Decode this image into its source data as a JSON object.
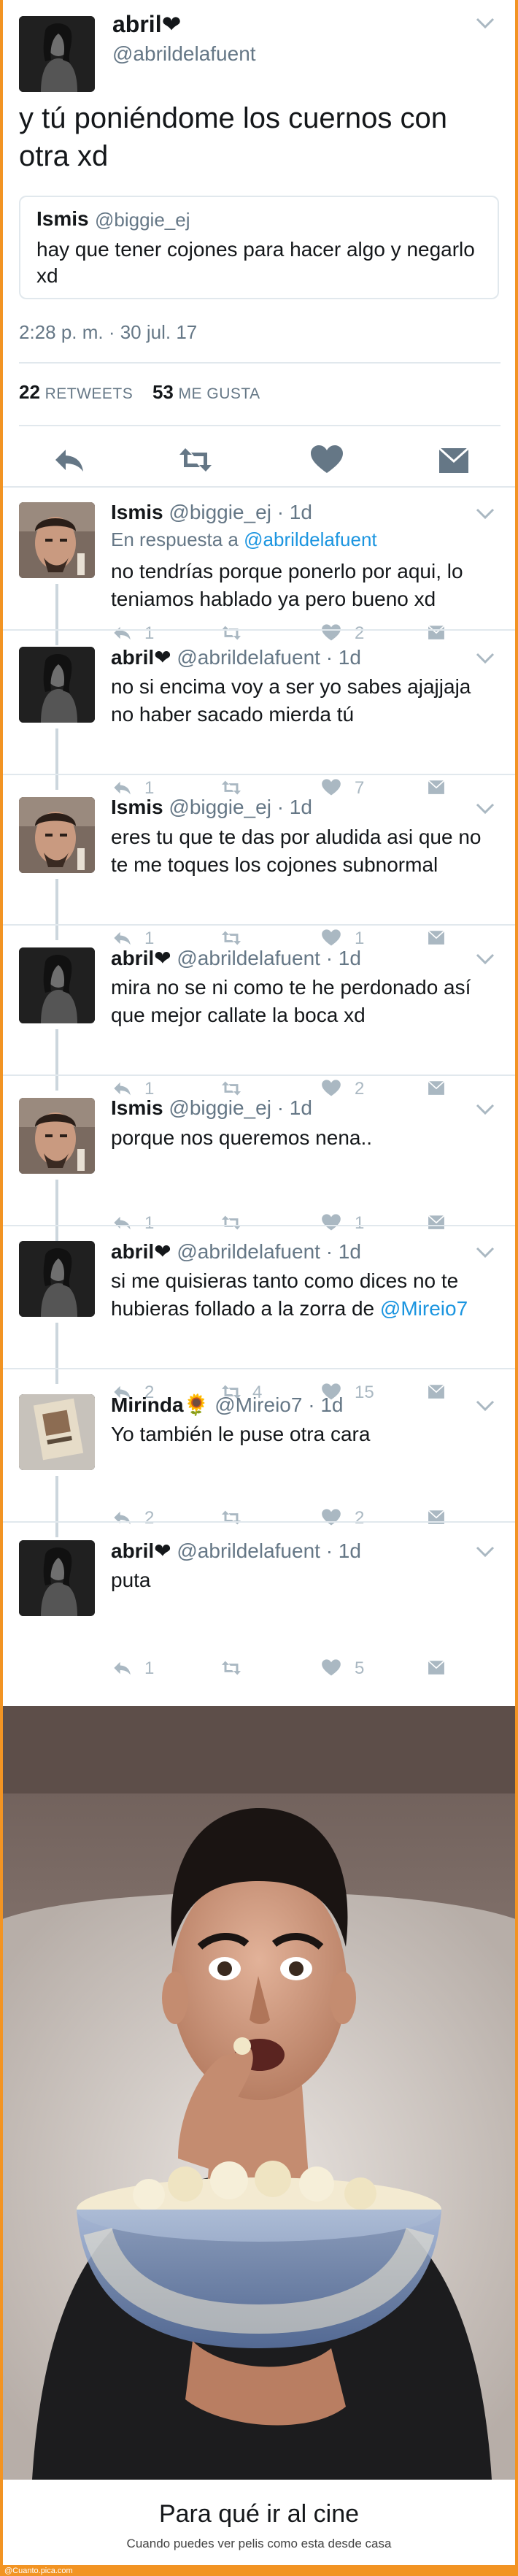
{
  "main_tweet": {
    "name": "abril❤",
    "handle": "@abrildelafuent",
    "text": "y tú poniéndome los cuernos con otra xd",
    "quoted": {
      "name": "Ismis",
      "handle": "@biggie_ej",
      "text": "hay que tener cojones para hacer algo y negarlo xd"
    },
    "timestamp": "2:28 p. m. · 30 jul. 17",
    "retweets_count": "22",
    "retweets_label": "RETWEETS",
    "likes_count": "53",
    "likes_label": "ME GUSTA",
    "icons": [
      "reply-icon",
      "retweet-icon",
      "like-icon",
      "message-icon"
    ]
  },
  "replies": [
    {
      "name": "Ismis",
      "handle": "@biggie_ej",
      "time": "· 1d",
      "in_reply_prefix": "En respuesta a ",
      "in_reply_to": "@abrildelafuent",
      "lines": [
        "no tendrías porque ponerlo por aqui, lo",
        "teniamos hablado ya pero bueno xd"
      ],
      "reply_count": "1",
      "retweet_count": "",
      "like_count": "2"
    },
    {
      "name": "abril❤",
      "handle": "@abrildelafuent",
      "time": "· 1d",
      "lines": [
        "no si encima voy a ser yo sabes ajajjaja",
        "no haber sacado mierda tú"
      ],
      "reply_count": "1",
      "retweet_count": "",
      "like_count": "7"
    },
    {
      "name": "Ismis",
      "handle": "@biggie_ej",
      "time": "· 1d",
      "lines": [
        "eres tu que te das por aludida asi que no",
        "te me toques los cojones subnormal"
      ],
      "reply_count": "1",
      "retweet_count": "",
      "like_count": "1"
    },
    {
      "name": "abril❤",
      "handle": "@abrildelafuent",
      "time": "· 1d",
      "lines": [
        "mira no se ni como te he perdonado así",
        "que mejor callate la boca xd"
      ],
      "reply_count": "1",
      "retweet_count": "",
      "like_count": "2"
    },
    {
      "name": "Ismis",
      "handle": "@biggie_ej",
      "time": "· 1d",
      "lines": [
        "porque nos queremos nena.."
      ],
      "reply_count": "1",
      "retweet_count": "",
      "like_count": "1"
    },
    {
      "name": "abril❤",
      "handle": "@abrildelafuent",
      "time": "· 1d",
      "lines": [
        "si me quisieras tanto como dices no te",
        "hubieras follado a la zorra de "
      ],
      "mention": "@Mireio7",
      "reply_count": "2",
      "retweet_count": "4",
      "like_count": "15"
    },
    {
      "name": "Mirinda🌻",
      "handle": "@Mireio7",
      "time": "· 1d",
      "lines": [
        "Yo también le puse otra cara"
      ],
      "reply_count": "2",
      "retweet_count": "",
      "like_count": "2"
    },
    {
      "name": "abril❤",
      "handle": "@abrildelafuent",
      "time": "· 1d",
      "lines": [
        "puta"
      ],
      "reply_count": "1",
      "retweet_count": "",
      "like_count": "5"
    }
  ],
  "meme": {
    "title": "Para qué ir al cine",
    "subtitle": "Cuando puedes ver pelis como esta desde casa"
  },
  "watermark": "@Cuanto.pica.com"
}
